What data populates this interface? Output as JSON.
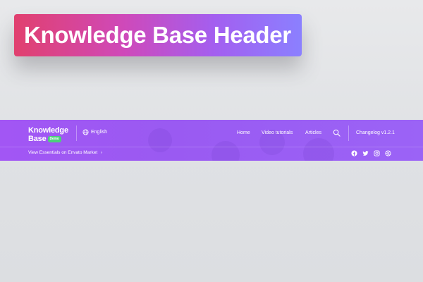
{
  "banner": {
    "title": "Knowledge Base Header"
  },
  "header": {
    "logo": {
      "line1": "Knowledge",
      "line2": "Base",
      "badge": "Demo"
    },
    "language": {
      "label": "English",
      "icon": "globe-icon"
    },
    "nav": [
      {
        "label": "Home"
      },
      {
        "label": "Video tutorials"
      },
      {
        "label": "Articles"
      }
    ],
    "search_icon": "search-icon",
    "changelog": "Changelog v1.2.1",
    "envato_link": "View Essentials on Envato Market",
    "envato_arrow": "›",
    "social": [
      "facebook-icon",
      "twitter-icon",
      "instagram-icon",
      "dribbble-icon"
    ],
    "colors": {
      "accent": "#9b5cf4",
      "badge": "#4ad07a"
    }
  }
}
